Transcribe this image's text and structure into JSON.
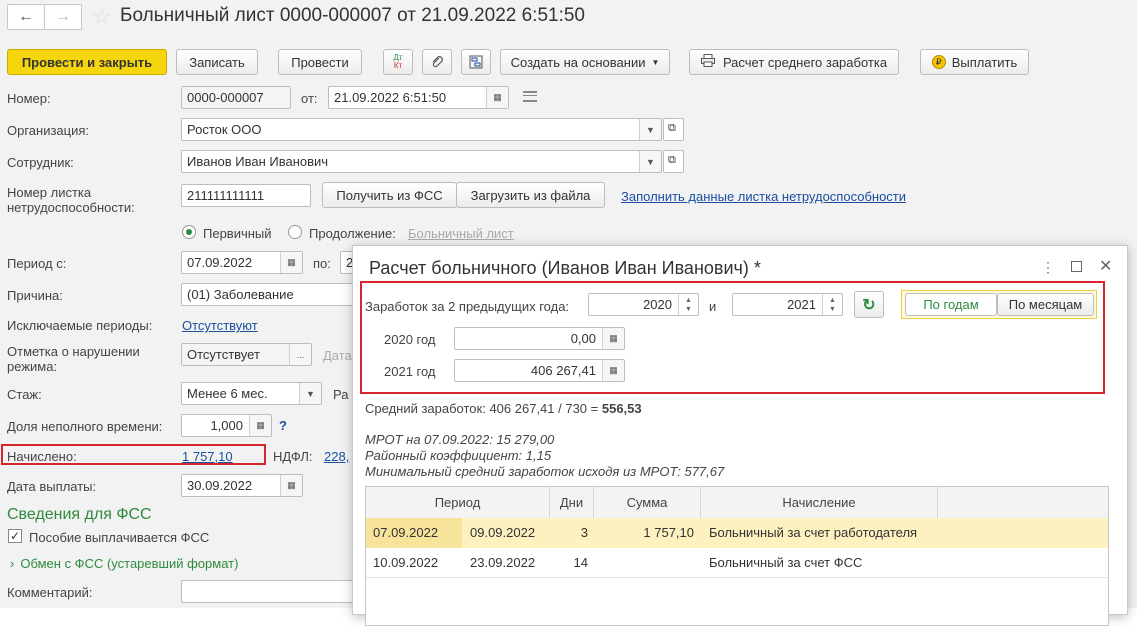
{
  "window": {
    "title": "Больничный лист 0000-000007 от 21.09.2022 6:51:50"
  },
  "toolbar": {
    "post_close": "Провести и закрыть",
    "save": "Записать",
    "post": "Провести",
    "create_based": "Создать на основании",
    "avg_earnings": "Расчет среднего заработка",
    "pay": "Выплатить"
  },
  "form": {
    "number_label": "Номер:",
    "number_value": "0000-000007",
    "from_label": "от:",
    "date_value": "21.09.2022  6:51:50",
    "org_label": "Организация:",
    "org_value": "Росток ООО",
    "employee_label": "Сотрудник:",
    "employee_value": "Иванов Иван Иванович",
    "sheet_label_1": "Номер листка",
    "sheet_label_2": "нетрудоспособности:",
    "sheet_value": "211111111111",
    "get_fss": "Получить из ФСС",
    "load_file": "Загрузить из файла",
    "fill_link": "Заполнить данные листка нетрудоспособности",
    "primary": "Первичный",
    "continuation": "Продолжение:",
    "sick_list_link": "Больничный лист",
    "period_label": "Период с:",
    "period_from": "07.09.2022",
    "period_to_label": "по:",
    "period_to_partial": "2",
    "reason_label": "Причина:",
    "reason_value": "(01) Заболевание",
    "excluded_label": "Исключаемые периоды:",
    "excluded_value": "Отсутствуют",
    "violation_label_1": "Отметка о нарушении",
    "violation_label_2": "режима:",
    "violation_value": "Отсутствует",
    "violation_date_label": "Дата",
    "experience_label": "Стаж:",
    "experience_value": "Менее 6 мес.",
    "experience_extra": "Ра",
    "part_time_label": "Доля неполного времени:",
    "part_time_value": "1,000",
    "help_mark": "?",
    "accrued_label": "Начислено:",
    "accrued_value": "1 757,10",
    "ndfl_label": "НДФЛ:",
    "ndfl_value": "228,",
    "pay_date_label": "Дата выплаты:",
    "pay_date_value": "30.09.2022",
    "fss_section": "Сведения для ФСС",
    "fss_checkbox": "Пособие выплачивается ФСС",
    "fss_exchange": "Обмен с ФСС (устаревший формат)",
    "comment_label": "Комментарий:"
  },
  "modal": {
    "title": "Расчет больничного (Иванов Иван Иванович) *",
    "earnings_label": "Заработок за 2 предыдущих года:",
    "year1": "2020",
    "and_label": "и",
    "year2": "2021",
    "by_years": "По годам",
    "by_months": "По месяцам",
    "year1_label": "2020 год",
    "year1_amount": "0,00",
    "year2_label": "2021 год",
    "year2_amount": "406 267,41",
    "avg_text": "Средний заработок: 406 267,41 / 730 = ",
    "avg_value": "556,53",
    "mrot": "МРОТ на 07.09.2022: 15 279,00",
    "regional": "Районный коэффициент: 1,15",
    "min_avg": "Минимальный средний заработок исходя из МРОТ: 577,67",
    "columns": [
      "Период",
      "Дни",
      "Сумма",
      "Начисление"
    ],
    "rows": [
      {
        "from": "07.09.2022",
        "to": "09.09.2022",
        "days": "3",
        "amount": "1 757,10",
        "accrual": "Больничный за счет работодателя"
      },
      {
        "from": "10.09.2022",
        "to": "23.09.2022",
        "days": "14",
        "amount": "",
        "accrual": "Больничный за счет ФСС"
      }
    ]
  },
  "colors": {
    "accent": "#f5d60d",
    "highlight": "#d6262c",
    "link": "#1a4fa0",
    "green": "#2e8b3e"
  }
}
